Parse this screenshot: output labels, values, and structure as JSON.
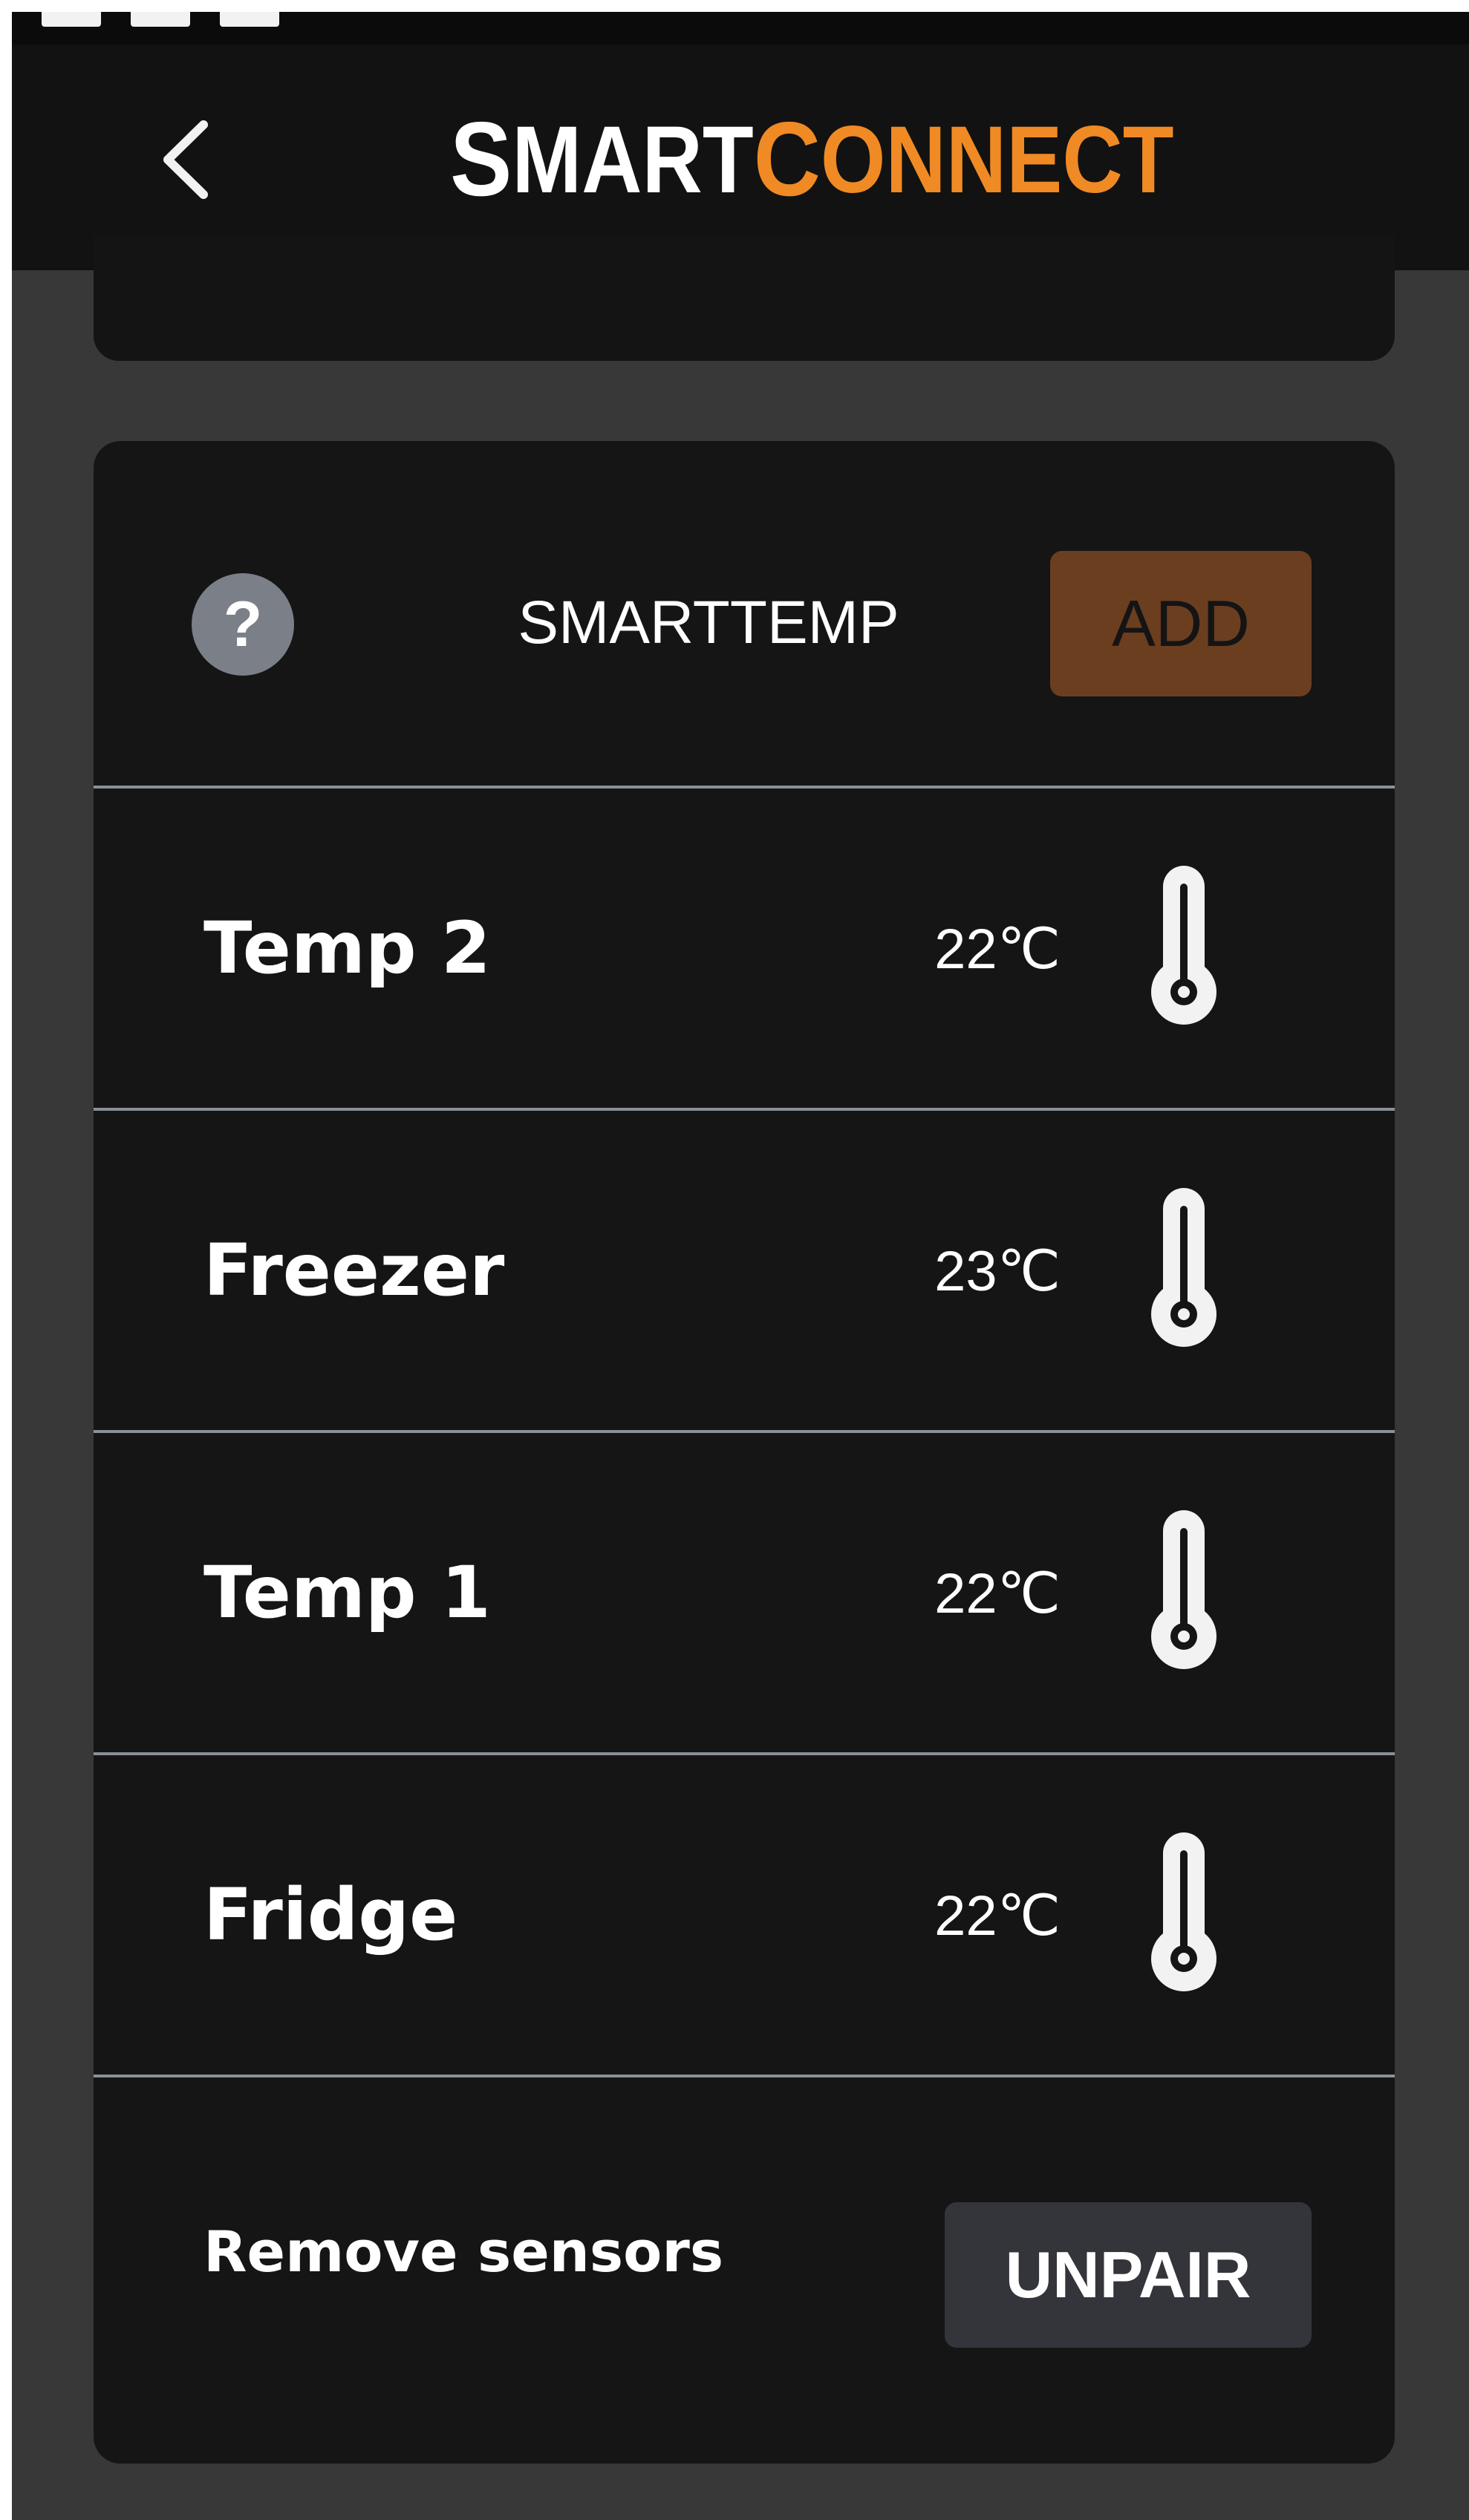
{
  "header": {
    "logo_part1_cap": "S",
    "logo_part1_rest": "MART",
    "logo_part2_cap": "C",
    "logo_part2_rest": "ONNECT",
    "back_icon": "chevron-left-icon"
  },
  "colors": {
    "accent": "#f08a24",
    "add_button_bg": "#6b3e20",
    "card_bg": "#151515",
    "page_bg": "#383838",
    "divider": "#8a9099"
  },
  "section": {
    "help_label": "?",
    "title": "SMARTTEMP",
    "add_label": "ADD"
  },
  "sensors": [
    {
      "name": "Temp 2",
      "temp": "22℃",
      "icon": "thermometer-icon"
    },
    {
      "name": "Freezer",
      "temp": "23℃",
      "icon": "thermometer-icon"
    },
    {
      "name": "Temp 1",
      "temp": "22℃",
      "icon": "thermometer-icon"
    },
    {
      "name": "Fridge",
      "temp": "22℃",
      "icon": "thermometer-icon"
    }
  ],
  "footer": {
    "remove_label": "Remove sensors",
    "unpair_label": "UNPAIR"
  }
}
